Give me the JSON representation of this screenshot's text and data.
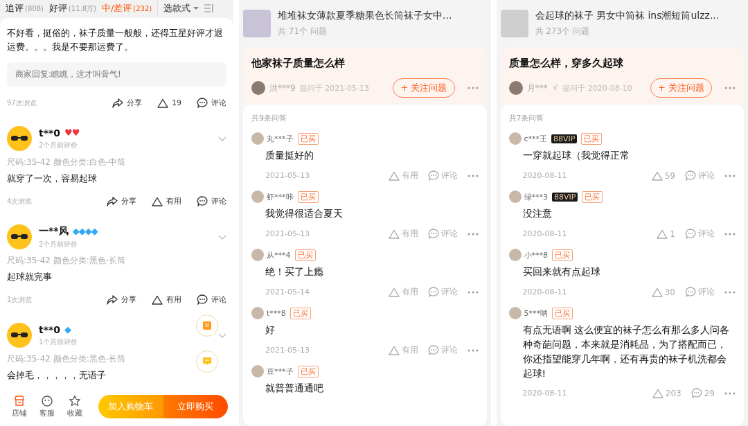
{
  "review_panel": {
    "tabs": [
      {
        "label": "追评",
        "count": "(808)",
        "selected": false
      },
      {
        "label": "好评",
        "count": "(11.8万)",
        "selected": false
      },
      {
        "label": "中/差评",
        "count": "(232)",
        "selected": true
      }
    ],
    "style_filter": "选款式",
    "reviews": [
      {
        "kind": "partial",
        "text": "不好看，挺俗的，袜子质量一般般，还得五星好评才退运费。。。我是不要那运费了。",
        "reply": "商家回复:瞧瞧，这才叫骨气!",
        "views": "97次浏览",
        "share": "分享",
        "useful": "19",
        "comment": "评论"
      },
      {
        "kind": "full",
        "name": "t**0",
        "badge": {
          "kind": "heart",
          "text": "♥♥"
        },
        "time": "2个月前评价",
        "spec": "尺码:35-42 颜色分类:白色-中筒",
        "text": "就穿了一次，容易起球",
        "views": "4次浏览",
        "share": "分享",
        "useful": "有用",
        "comment": "评论"
      },
      {
        "kind": "full",
        "name": "一**风",
        "badge": {
          "kind": "diamond",
          "text": "◆◆◆◆"
        },
        "time": "2个月前评价",
        "spec": "尺码:35-42 颜色分类:黑色-长筒",
        "text": "起球就完事",
        "views": "1次浏览",
        "share": "分享",
        "useful": "有用",
        "comment": "评论"
      },
      {
        "kind": "full",
        "name": "t**0",
        "badge": {
          "kind": "diamond",
          "text": "◆"
        },
        "time": "1个月前评价",
        "spec": "尺码:35-42 颜色分类:黑色-长筒",
        "text": "会掉毛，，，，，无语子"
      }
    ],
    "bottom_bar": {
      "icons": [
        {
          "kind": "store",
          "label": "店铺"
        },
        {
          "kind": "service",
          "label": "客服"
        },
        {
          "kind": "star",
          "label": "收藏"
        }
      ],
      "cart_button": "加入购物车",
      "buy_button": "立即购买"
    }
  },
  "qa_panels": [
    {
      "product_title": "堆堆袜女薄款夏季糖果色长筒袜子女中...",
      "question_count": "共 71个 问题",
      "question": {
        "title": "他家袜子质量怎么样",
        "asker": "洪***9",
        "asked": "提问于 2021-05-13",
        "follow_button": "+ 关注问题"
      },
      "answer_count": "共9条问答",
      "answers": [
        {
          "name": "丸***子",
          "tag": "已买",
          "text": "质量挺好的",
          "date": "2021-05-13",
          "useful": "有用",
          "comment": "评论"
        },
        {
          "name": "虾***咔",
          "tag": "已买",
          "text": "我觉得很适合夏天",
          "date": "2021-05-13",
          "useful": "有用",
          "comment": "评论"
        },
        {
          "name": "从***4",
          "tag": "已买",
          "text": "绝！买了上瘾",
          "date": "2021-05-14",
          "useful": "有用",
          "comment": "评论"
        },
        {
          "name": "t***8",
          "tag": "已买",
          "text": "好",
          "date": "2021-05-13",
          "useful": "有用",
          "comment": "评论"
        },
        {
          "name": "豆***子",
          "tag": "已买",
          "text": "就普普通通吧"
        }
      ]
    },
    {
      "product_title": "会起球的袜子 男女中筒袜 ins潮短筒ulzz...",
      "question_count": "共 273个 问题",
      "question": {
        "title": "质量怎么样，穿多久起球",
        "asker": "月*** ヾ",
        "asked": "提问于 2020-08-10",
        "follow_button": "+ 关注问题"
      },
      "answer_count": "共7条问答",
      "answers": [
        {
          "name": "c***王",
          "vip": "88VIP",
          "tag": "已买",
          "text": "一穿就起球（我觉得正常",
          "date": "2020-08-11",
          "useful": "59",
          "comment": "评论"
        },
        {
          "name": "绿***3",
          "vip": "88VIP",
          "tag": "已买",
          "text": "没注意",
          "date": "2020-08-11",
          "useful": "1",
          "comment": "评论"
        },
        {
          "name": "小***8",
          "tag": "已买",
          "text": "买回来就有点起球",
          "date": "2020-08-11",
          "useful": "30",
          "comment": "评论"
        },
        {
          "name": "5***呐",
          "tag": "已买",
          "text": "有点无语啊 这么便宜的袜子怎么有那么多人问各种奇葩问题，本来就是消耗品，为了搭配而已，你还指望能穿几年啊，还有再贵的袜子机洗都会起球!",
          "date": "2020-08-11",
          "useful": "203",
          "comment": "29"
        }
      ]
    }
  ]
}
